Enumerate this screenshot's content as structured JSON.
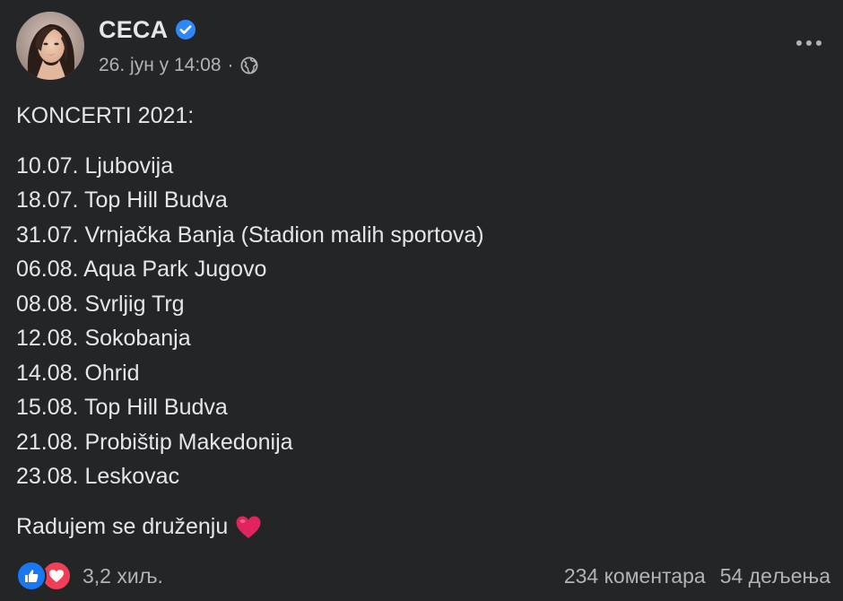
{
  "post": {
    "author": "CECA",
    "verified": true,
    "timestamp": "26. јун у 14:08",
    "separator": "·",
    "audience_icon": "globe-icon",
    "heading": "KONCERTI 2021:",
    "concerts": [
      "10.07. Ljubovija",
      "18.07. Top Hill Budva",
      "31.07. Vrnjačka Banja (Stadion malih sportova)",
      "06.08. Aqua Park Jugovo",
      "08.08. Svrljig Trg",
      "12.08. Sokobanja",
      "14.08. Ohrid",
      "15.08. Top Hill Budva",
      "21.08. Probištip Makedonija",
      "23.08. Leskovac"
    ],
    "closing": "Radujem se druženju",
    "closing_emoji": "red-heart-icon"
  },
  "footer": {
    "reactions_count": "3,2 хиљ.",
    "reaction_types": [
      "like-icon",
      "love-icon"
    ],
    "comments": "234 коментара",
    "shares": "54 дељења"
  },
  "colors": {
    "background": "#242526",
    "primary_text": "#e4e6eb",
    "secondary_text": "#b0b3b8",
    "verified_blue": "#2d88ff",
    "like_blue": "#1877f2",
    "love_red": "#f33e58",
    "heart_red": "#e0245e"
  }
}
